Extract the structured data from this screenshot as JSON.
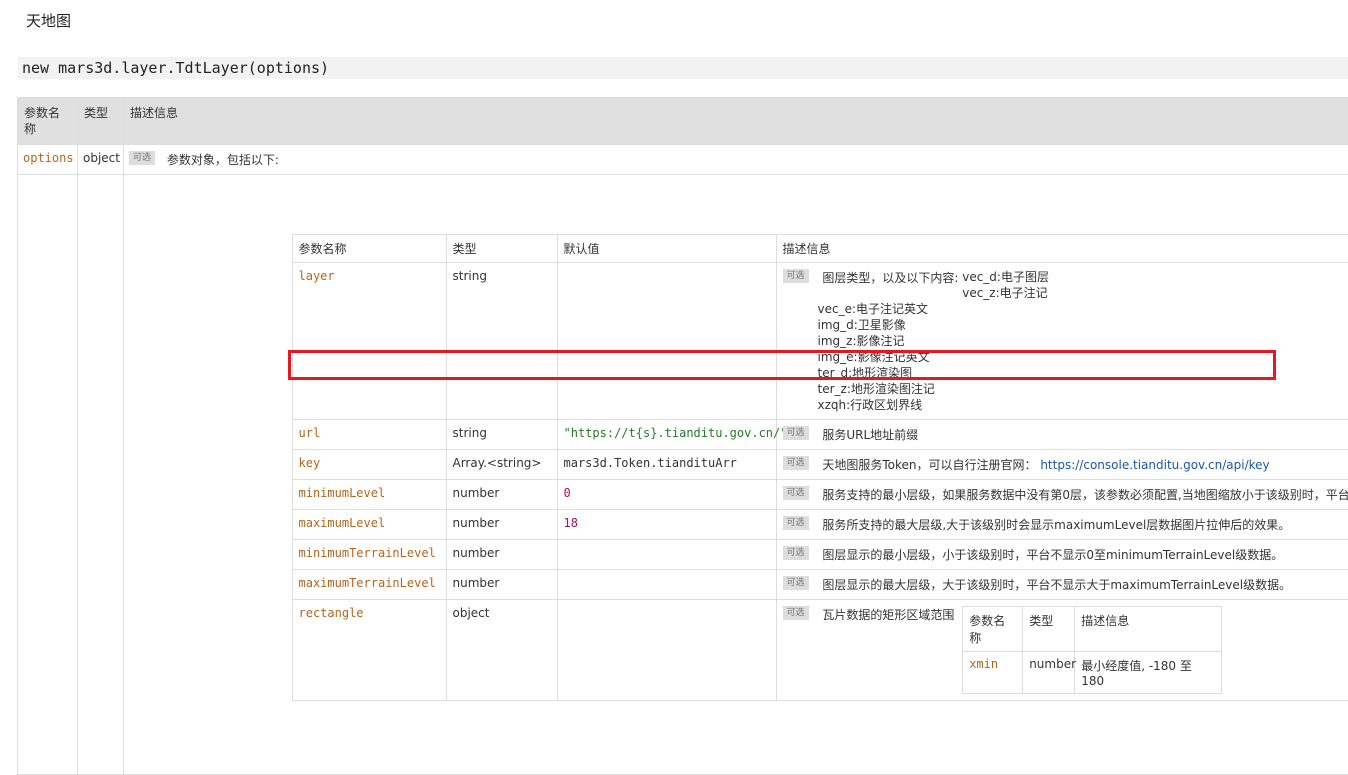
{
  "page": {
    "title": "天地图",
    "signature": "new mars3d.layer.TdtLayer(options)"
  },
  "outer_headers": [
    "参数名称",
    "类型",
    "描述信息"
  ],
  "options_row": {
    "name": "options",
    "type": "object",
    "badge": "可选",
    "desc": "参数对象，包括以下:"
  },
  "inner_headers": [
    "参数名称",
    "类型",
    "默认值",
    "描述信息"
  ],
  "rows": {
    "layer": {
      "name": "layer",
      "type": "string",
      "default": "",
      "badge": "可选",
      "desc_intro": "图层类型，以及以下内容:",
      "options": [
        "vec_d:电子图层",
        "vec_z:电子注记",
        "vec_e:电子注记英文",
        "img_d:卫星影像",
        "img_z:影像注记",
        "img_e:影像注记英文",
        "ter_d:地形渲染图",
        "ter_z:地形渲染图注记",
        "xzqh:行政区划界线"
      ]
    },
    "url": {
      "name": "url",
      "type": "string",
      "default": "\"https://t{s}.tianditu.gov.cn/\"",
      "badge": "可选",
      "desc": "服务URL地址前缀"
    },
    "key": {
      "name": "key",
      "type": "Array.<string>",
      "default": "mars3d.Token.tiandituArr",
      "badge": "可选",
      "desc": "天地图服务Token，可以自行注册官网：",
      "link": "https://console.tianditu.gov.cn/api/key"
    },
    "minimumLevel": {
      "name": "minimumLevel",
      "type": "number",
      "default": "0",
      "badge": "可选",
      "desc": "服务支持的最小层级，如果服务数据中没有第0层，该参数必须配置,当地图缩放小于该级别时，平台会"
    },
    "maximumLevel": {
      "name": "maximumLevel",
      "type": "number",
      "default": "18",
      "badge": "可选",
      "desc": "服务所支持的最大层级,大于该级别时会显示maximumLevel层数据图片拉伸后的效果。"
    },
    "minimumTerrainLevel": {
      "name": "minimumTerrainLevel",
      "type": "number",
      "default": "",
      "badge": "可选",
      "desc": "图层显示的最小层级，小于该级别时，平台不显示0至minimumTerrainLevel级数据。"
    },
    "maximumTerrainLevel": {
      "name": "maximumTerrainLevel",
      "type": "number",
      "default": "",
      "badge": "可选",
      "desc": "图层显示的最大层级，大于该级别时，平台不显示大于maximumTerrainLevel级数据。"
    },
    "rectangle": {
      "name": "rectangle",
      "type": "object",
      "default": "",
      "badge": "可选",
      "desc": "瓦片数据的矩形区域范围"
    }
  },
  "rect_sub": {
    "headers": [
      "参数名称",
      "类型",
      "描述信息"
    ],
    "xmin": {
      "name": "xmin",
      "type": "number",
      "desc": "最小经度值, -180 至 180"
    }
  }
}
